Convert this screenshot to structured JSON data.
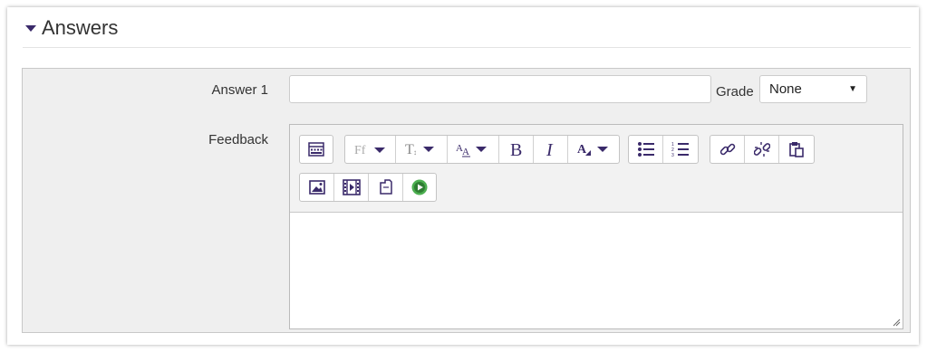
{
  "section": {
    "title": "Answers"
  },
  "answer": {
    "label": "Answer 1",
    "value": "",
    "grade_label": "Grade",
    "grade_value": "None"
  },
  "feedback": {
    "label": "Feedback",
    "content": ""
  },
  "toolbar": {
    "row1": [
      [
        "toolbar-toggle-icon"
      ],
      [
        "font-family-icon",
        "font-size-icon",
        "paragraph-style-icon",
        "bold-icon",
        "italic-icon",
        "text-color-icon"
      ],
      [
        "unordered-list-icon",
        "ordered-list-icon"
      ],
      [
        "link-icon",
        "unlink-icon",
        "paste-icon"
      ]
    ],
    "row2": [
      [
        "image-icon",
        "media-icon",
        "manage-files-icon",
        "record-video-icon"
      ]
    ]
  },
  "colors": {
    "accent": "#4a2a7a",
    "panel": "#efefef"
  }
}
